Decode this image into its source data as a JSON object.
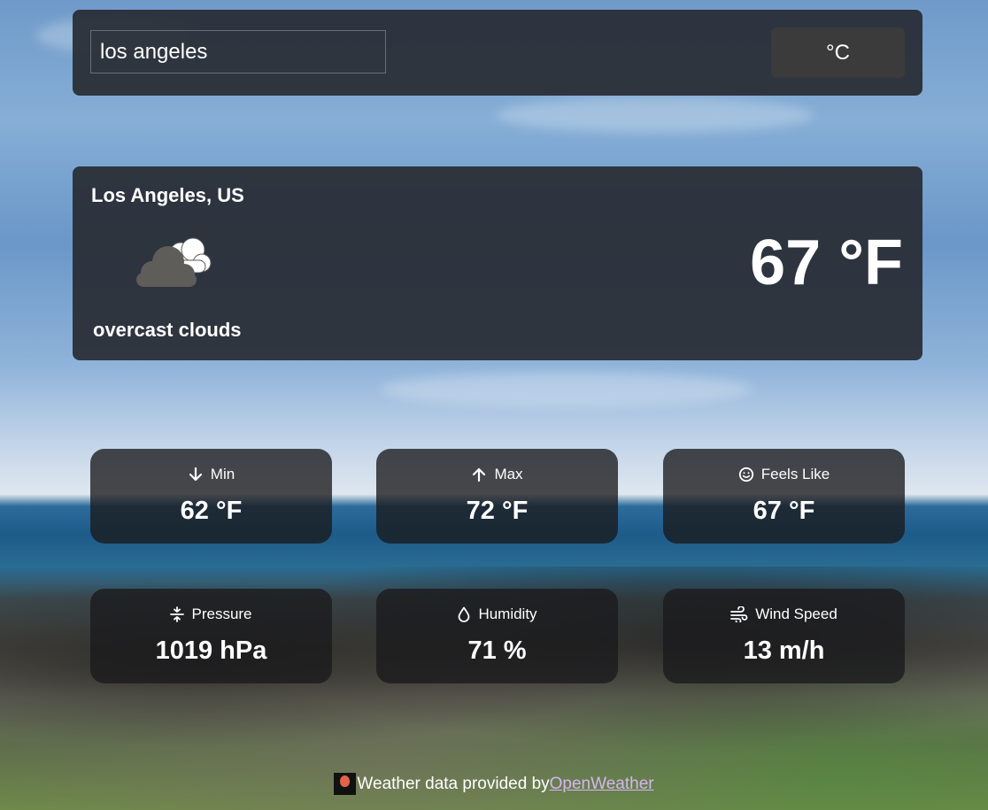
{
  "search": {
    "value": "los angeles",
    "unit_toggle_label": "°C"
  },
  "current": {
    "location": "Los Angeles, US",
    "icon": "overcast-clouds-icon",
    "description": "overcast clouds",
    "temperature": "67 °F"
  },
  "stats": [
    {
      "label": "Min",
      "icon": "arrow-down-icon",
      "value": "62 °F"
    },
    {
      "label": "Max",
      "icon": "arrow-up-icon",
      "value": "72 °F"
    },
    {
      "label": "Feels Like",
      "icon": "smiley-icon",
      "value": "67 °F"
    },
    {
      "label": "Pressure",
      "icon": "pressure-icon",
      "value": "1019 hPa"
    },
    {
      "label": "Humidity",
      "icon": "droplet-icon",
      "value": "71 %"
    },
    {
      "label": "Wind Speed",
      "icon": "wind-icon",
      "value": "13 m/h"
    }
  ],
  "footer": {
    "text": "Weather data provided by",
    "link_text": "OpenWeather"
  },
  "colors": {
    "panel": "#282c34",
    "unit_button": "#3b3b3c",
    "link": "#d7b5f0"
  }
}
